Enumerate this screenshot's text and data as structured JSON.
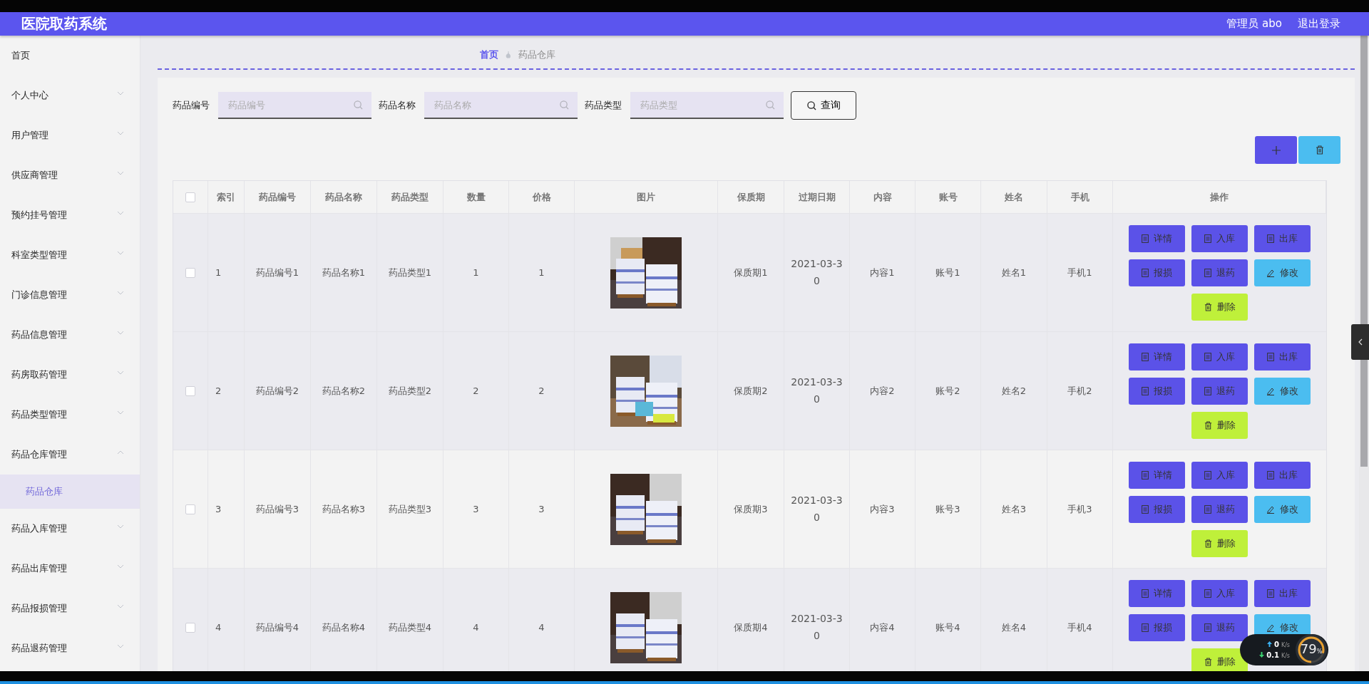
{
  "header": {
    "title": "医院取药系统",
    "user": "管理员 abo",
    "logout": "退出登录"
  },
  "sidebar": {
    "items": [
      {
        "label": "首页",
        "kind": "link"
      },
      {
        "label": "个人中心",
        "kind": "menu",
        "expanded": false
      },
      {
        "label": "用户管理",
        "kind": "menu",
        "expanded": false
      },
      {
        "label": "供应商管理",
        "kind": "menu",
        "expanded": false
      },
      {
        "label": "预约挂号管理",
        "kind": "menu",
        "expanded": false
      },
      {
        "label": "科室类型管理",
        "kind": "menu",
        "expanded": false
      },
      {
        "label": "门诊信息管理",
        "kind": "menu",
        "expanded": false
      },
      {
        "label": "药品信息管理",
        "kind": "menu",
        "expanded": false
      },
      {
        "label": "药房取药管理",
        "kind": "menu",
        "expanded": false
      },
      {
        "label": "药品类型管理",
        "kind": "menu",
        "expanded": false
      },
      {
        "label": "药品仓库管理",
        "kind": "menu",
        "expanded": true,
        "children": [
          {
            "label": "药品仓库",
            "selected": true
          }
        ]
      },
      {
        "label": "药品入库管理",
        "kind": "menu",
        "expanded": false
      },
      {
        "label": "药品出库管理",
        "kind": "menu",
        "expanded": false
      },
      {
        "label": "药品报损管理",
        "kind": "menu",
        "expanded": false
      },
      {
        "label": "药品退药管理",
        "kind": "menu",
        "expanded": false
      }
    ]
  },
  "breadcrumb": [
    "首页",
    "药品仓库"
  ],
  "search": {
    "fields": [
      {
        "label": "药品编号",
        "placeholder": "药品编号"
      },
      {
        "label": "药品名称",
        "placeholder": "药品名称"
      },
      {
        "label": "药品类型",
        "placeholder": "药品类型"
      }
    ],
    "button": "查询"
  },
  "table": {
    "all_checked": false,
    "columns": [
      "索引",
      "药品编号",
      "药品名称",
      "药品类型",
      "数量",
      "价格",
      "图片",
      "保质期",
      "过期日期",
      "内容",
      "账号",
      "姓名",
      "手机",
      "操作"
    ],
    "rows": [
      {
        "checked": false,
        "cells": [
          "1",
          "药品编号1",
          "药品名称1",
          "药品类型1",
          "1",
          "1",
          "",
          "保质期1",
          "2021-03-30",
          "内容1",
          "账号1",
          "姓名1",
          "手机1"
        ],
        "image": {
          "kind": "picture"
        },
        "actions": [
          {
            "kind": "doc",
            "label": "详情"
          },
          {
            "kind": "doc",
            "label": "入库"
          },
          {
            "kind": "doc",
            "label": "出库"
          },
          {
            "kind": "doc",
            "label": "报损"
          },
          {
            "kind": "doc",
            "label": "退药"
          },
          {
            "kind": "edit",
            "label": "修改"
          },
          {
            "kind": "delete",
            "label": "删除"
          }
        ]
      },
      {
        "checked": false,
        "cells": [
          "2",
          "药品编号2",
          "药品名称2",
          "药品类型2",
          "2",
          "2",
          "",
          "保质期2",
          "2021-03-30",
          "内容2",
          "账号2",
          "姓名2",
          "手机2"
        ],
        "image": {
          "kind": "picture"
        },
        "actions": [
          {
            "kind": "doc",
            "label": "详情"
          },
          {
            "kind": "doc",
            "label": "入库"
          },
          {
            "kind": "doc",
            "label": "出库"
          },
          {
            "kind": "doc",
            "label": "报损"
          },
          {
            "kind": "doc",
            "label": "退药"
          },
          {
            "kind": "edit",
            "label": "修改"
          },
          {
            "kind": "delete",
            "label": "删除"
          }
        ]
      },
      {
        "checked": false,
        "cells": [
          "3",
          "药品编号3",
          "药品名称3",
          "药品类型3",
          "3",
          "3",
          "",
          "保质期3",
          "2021-03-30",
          "内容3",
          "账号3",
          "姓名3",
          "手机3"
        ],
        "image": {
          "kind": "picture"
        },
        "actions": [
          {
            "kind": "doc",
            "label": "详情"
          },
          {
            "kind": "doc",
            "label": "入库"
          },
          {
            "kind": "doc",
            "label": "出库"
          },
          {
            "kind": "doc",
            "label": "报损"
          },
          {
            "kind": "doc",
            "label": "退药"
          },
          {
            "kind": "edit",
            "label": "修改"
          },
          {
            "kind": "delete",
            "label": "删除"
          }
        ]
      },
      {
        "checked": false,
        "cells": [
          "4",
          "药品编号4",
          "药品名称4",
          "药品类型4",
          "4",
          "4",
          "",
          "保质期4",
          "2021-03-30",
          "内容4",
          "账号4",
          "姓名4",
          "手机4"
        ],
        "image": {
          "kind": "picture"
        },
        "actions": [
          {
            "kind": "doc",
            "label": "详情"
          },
          {
            "kind": "doc",
            "label": "入库"
          },
          {
            "kind": "doc",
            "label": "出库"
          },
          {
            "kind": "doc",
            "label": "报损"
          },
          {
            "kind": "doc",
            "label": "退药"
          },
          {
            "kind": "edit",
            "label": "修改"
          },
          {
            "kind": "delete",
            "label": "删除"
          }
        ]
      }
    ]
  },
  "net_widget": {
    "upload": "0",
    "download": "0.1",
    "upload_unit": "K/s",
    "download_unit": "K/s",
    "load": "79",
    "percent": "%",
    "level": 0.79
  }
}
